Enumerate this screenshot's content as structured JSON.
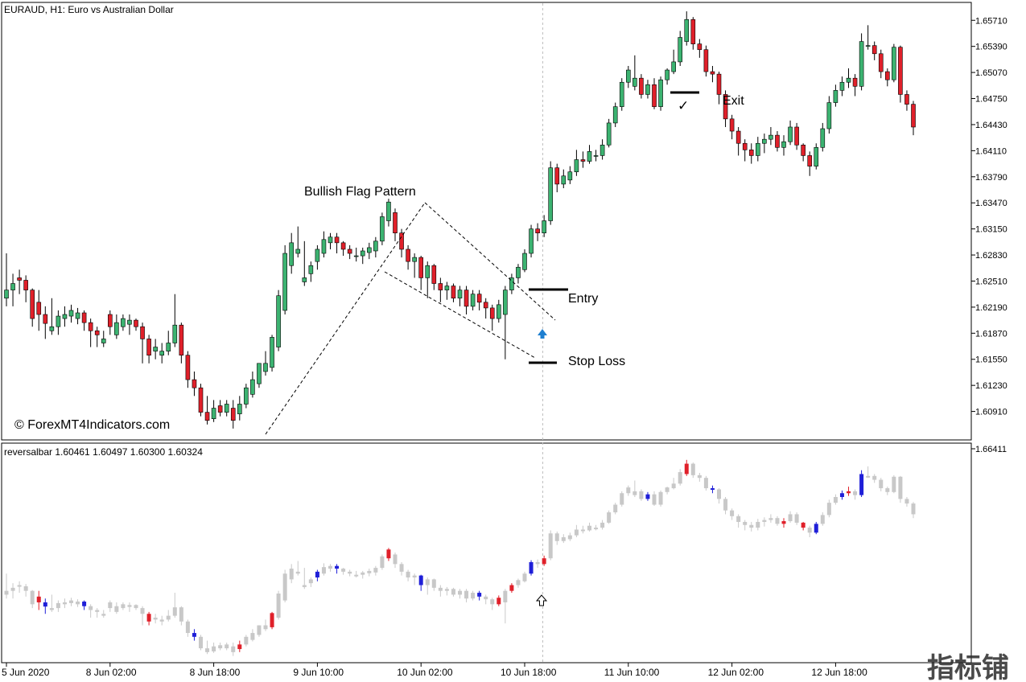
{
  "window": {
    "main_title": "EURAUD, H1:  Euro vs Australian Dollar",
    "indicator_title": "reversalbar 1.60461 1.60497 1.60300 1.60324",
    "watermark": "© ForexMT4Indicators.com",
    "corner_logo": "指标铺"
  },
  "annotations": {
    "pattern": "Bullish Flag Pattern",
    "entry": "Entry",
    "stop_loss": "Stop Loss",
    "exit": "Exit",
    "check_mark": "✓"
  },
  "colors": {
    "bull_candle": "#3cb371",
    "bear_candle": "#e0202a",
    "neutral_bar": "#c8c8c8",
    "signal_up": "#1f1fd8",
    "signal_down": "#e0202a",
    "arrow": "#1e7fd0",
    "grid_line": "#cfcfcf"
  },
  "chart_data": [
    {
      "type": "candlestick",
      "title": "EURAUD, H1:  Euro vs Australian Dollar",
      "y_ticks": [
        "1.65710",
        "1.65390",
        "1.65070",
        "1.64750",
        "1.64430",
        "1.64110",
        "1.63790",
        "1.63470",
        "1.63150",
        "1.62830",
        "1.62510",
        "1.62190",
        "1.61870",
        "1.61550",
        "1.61230",
        "1.60910"
      ],
      "ylim": [
        1.606,
        1.659
      ],
      "x_ticks": [
        "5 Jun 2020",
        "8 Jun 02:00",
        "8 Jun 18:00",
        "9 Jun 10:00",
        "10 Jun 02:00",
        "10 Jun 18:00",
        "11 Jun 10:00",
        "12 Jun 02:00",
        "12 Jun 18:00"
      ],
      "x_tick_index": [
        0,
        16,
        32,
        48,
        64,
        80,
        96,
        112,
        128
      ],
      "close": [
        1.624,
        1.6248,
        1.6252,
        1.624,
        1.6205,
        1.621,
        1.6199,
        1.6195,
        1.6208,
        1.621,
        1.6215,
        1.6212,
        1.62,
        1.619,
        1.6185,
        1.618,
        1.6195,
        1.62,
        1.6205,
        1.6203,
        1.6195,
        1.618,
        1.616,
        1.617,
        1.6165,
        1.6175,
        1.6197,
        1.616,
        1.613,
        1.612,
        1.609,
        1.608,
        1.6095,
        1.609,
        1.61,
        1.608,
        1.61,
        1.612,
        1.613,
        1.615,
        1.615,
        1.6182,
        1.6233,
        1.6285,
        1.6298,
        1.629,
        1.6255,
        1.627,
        1.629,
        1.6302,
        1.6305,
        1.6298,
        1.629,
        1.6285,
        1.6282,
        1.6288,
        1.6292,
        1.63,
        1.633,
        1.6348,
        1.631,
        1.629,
        1.6275,
        1.628,
        1.6255,
        1.627,
        1.6248,
        1.624,
        1.6245,
        1.623,
        1.624,
        1.622,
        1.6235,
        1.6225,
        1.6218,
        1.6205,
        1.6222,
        1.624,
        1.6255,
        1.6268,
        1.6285,
        1.6315,
        1.631,
        1.6325,
        1.639,
        1.637,
        1.638,
        1.6385,
        1.64,
        1.6398,
        1.641,
        1.6405,
        1.6418,
        1.6445,
        1.6465,
        1.6495,
        1.651,
        1.65,
        1.648,
        1.6492,
        1.6465,
        1.6498,
        1.651,
        1.652,
        1.655,
        1.6572,
        1.6542,
        1.6535,
        1.6508,
        1.6505,
        1.648,
        1.645,
        1.6435,
        1.642,
        1.6412,
        1.6405,
        1.642,
        1.6425,
        1.643,
        1.6415,
        1.6422,
        1.644,
        1.6418,
        1.6405,
        1.6392,
        1.6415,
        1.6438,
        1.647,
        1.6485,
        1.6495,
        1.65,
        1.649,
        1.6545,
        1.654,
        1.653,
        1.6508,
        1.6498,
        1.6538,
        1.648,
        1.6468,
        1.644
      ],
      "up_indices": [
        0,
        1,
        7,
        8,
        9,
        10,
        11,
        15,
        17,
        18,
        19,
        22,
        24,
        25,
        32,
        34,
        35,
        36,
        37,
        38,
        40,
        41,
        42,
        43,
        44,
        45,
        46,
        47,
        48,
        49,
        50,
        54,
        55,
        56,
        57,
        58,
        59,
        71,
        72,
        76,
        77,
        78,
        79,
        80,
        81,
        83,
        84,
        86,
        87,
        88,
        89,
        90,
        91,
        92,
        93,
        94,
        95,
        96,
        97,
        98,
        99,
        101,
        102,
        103,
        104,
        105,
        116,
        117,
        118,
        119,
        120,
        122,
        123,
        125,
        126,
        127,
        128,
        129,
        130,
        131,
        132,
        133,
        135
      ],
      "ohlc": [
        [
          1.623,
          1.6285,
          1.622,
          1.624
        ],
        [
          1.624,
          1.626,
          1.622,
          1.6248
        ],
        [
          1.6255,
          1.6265,
          1.6235,
          1.6252
        ],
        [
          1.6252,
          1.6258,
          1.6225,
          1.624
        ],
        [
          1.624,
          1.6242,
          1.6195,
          1.6205
        ],
        [
          1.6225,
          1.624,
          1.619,
          1.621
        ],
        [
          1.621,
          1.622,
          1.618,
          1.6199
        ],
        [
          1.619,
          1.623,
          1.6185,
          1.6195
        ],
        [
          1.6195,
          1.6215,
          1.6185,
          1.6208
        ],
        [
          1.6205,
          1.622,
          1.6195,
          1.621
        ],
        [
          1.6208,
          1.6222,
          1.62,
          1.6215
        ],
        [
          1.6205,
          1.6218,
          1.6198,
          1.6212
        ],
        [
          1.6212,
          1.6215,
          1.619,
          1.62
        ],
        [
          1.62,
          1.6205,
          1.617,
          1.619
        ],
        [
          1.619,
          1.6195,
          1.617,
          1.6185
        ],
        [
          1.6175,
          1.619,
          1.617,
          1.618
        ],
        [
          1.621,
          1.6215,
          1.6185,
          1.6195
        ],
        [
          1.6185,
          1.621,
          1.618,
          1.62
        ],
        [
          1.6195,
          1.621,
          1.619,
          1.6205
        ],
        [
          1.6198,
          1.621,
          1.6185,
          1.6203
        ],
        [
          1.6203,
          1.6205,
          1.619,
          1.6195
        ],
        [
          1.6195,
          1.62,
          1.615,
          1.618
        ],
        [
          1.618,
          1.6185,
          1.615,
          1.616
        ],
        [
          1.6165,
          1.618,
          1.6155,
          1.617
        ],
        [
          1.616,
          1.6175,
          1.615,
          1.6165
        ],
        [
          1.6165,
          1.619,
          1.616,
          1.6175
        ],
        [
          1.6175,
          1.6235,
          1.617,
          1.6197
        ],
        [
          1.6197,
          1.62,
          1.615,
          1.616
        ],
        [
          1.616,
          1.6165,
          1.612,
          1.613
        ],
        [
          1.613,
          1.614,
          1.611,
          1.612
        ],
        [
          1.612,
          1.6125,
          1.6085,
          1.609
        ],
        [
          1.609,
          1.611,
          1.6075,
          1.608
        ],
        [
          1.6082,
          1.6105,
          1.6078,
          1.6095
        ],
        [
          1.6098,
          1.6105,
          1.6085,
          1.609
        ],
        [
          1.609,
          1.6105,
          1.6085,
          1.61
        ],
        [
          1.6095,
          1.6105,
          1.607,
          1.608
        ],
        [
          1.6088,
          1.611,
          1.608,
          1.61
        ],
        [
          1.61,
          1.6125,
          1.6095,
          1.612
        ],
        [
          1.6112,
          1.614,
          1.6108,
          1.613
        ],
        [
          1.6125,
          1.615,
          1.612,
          1.615
        ],
        [
          1.614,
          1.6165,
          1.6135,
          1.615
        ],
        [
          1.6145,
          1.6185,
          1.614,
          1.6182
        ],
        [
          1.617,
          1.624,
          1.6165,
          1.6233
        ],
        [
          1.6215,
          1.6295,
          1.621,
          1.6285
        ],
        [
          1.627,
          1.631,
          1.626,
          1.6298
        ],
        [
          1.6285,
          1.6318,
          1.628,
          1.629
        ],
        [
          1.625,
          1.63,
          1.6245,
          1.6255
        ],
        [
          1.626,
          1.6275,
          1.625,
          1.627
        ],
        [
          1.6275,
          1.6295,
          1.6265,
          1.629
        ],
        [
          1.6285,
          1.6312,
          1.628,
          1.6302
        ],
        [
          1.6298,
          1.631,
          1.629,
          1.6305
        ],
        [
          1.6305,
          1.631,
          1.6285,
          1.6298
        ],
        [
          1.6298,
          1.63,
          1.6282,
          1.629
        ],
        [
          1.629,
          1.6295,
          1.6278,
          1.6285
        ],
        [
          1.6282,
          1.6292,
          1.6275,
          1.6282
        ],
        [
          1.6282,
          1.6292,
          1.6272,
          1.6288
        ],
        [
          1.6286,
          1.6298,
          1.6278,
          1.6292
        ],
        [
          1.6288,
          1.6305,
          1.628,
          1.63
        ],
        [
          1.63,
          1.6335,
          1.6295,
          1.633
        ],
        [
          1.6325,
          1.6352,
          1.6318,
          1.6348
        ],
        [
          1.6335,
          1.634,
          1.63,
          1.631
        ],
        [
          1.631,
          1.6315,
          1.628,
          1.629
        ],
        [
          1.629,
          1.6295,
          1.6265,
          1.6275
        ],
        [
          1.6275,
          1.6285,
          1.6255,
          1.628
        ],
        [
          1.628,
          1.6282,
          1.624,
          1.6255
        ],
        [
          1.6255,
          1.6275,
          1.623,
          1.627
        ],
        [
          1.627,
          1.6272,
          1.624,
          1.6248
        ],
        [
          1.6248,
          1.6255,
          1.6225,
          1.624
        ],
        [
          1.624,
          1.625,
          1.6228,
          1.6245
        ],
        [
          1.6245,
          1.6248,
          1.6225,
          1.623
        ],
        [
          1.623,
          1.6245,
          1.622,
          1.624
        ],
        [
          1.624,
          1.6245,
          1.621,
          1.622
        ],
        [
          1.622,
          1.624,
          1.6215,
          1.6235
        ],
        [
          1.6235,
          1.624,
          1.6215,
          1.6225
        ],
        [
          1.6225,
          1.623,
          1.6205,
          1.6218
        ],
        [
          1.6218,
          1.6222,
          1.619,
          1.6205
        ],
        [
          1.6205,
          1.6228,
          1.62,
          1.6222
        ],
        [
          1.621,
          1.6245,
          1.6155,
          1.624
        ],
        [
          1.624,
          1.626,
          1.6235,
          1.6255
        ],
        [
          1.6255,
          1.6272,
          1.6248,
          1.6268
        ],
        [
          1.6265,
          1.629,
          1.6262,
          1.6285
        ],
        [
          1.6285,
          1.632,
          1.628,
          1.6315
        ],
        [
          1.6315,
          1.6322,
          1.63,
          1.631
        ],
        [
          1.631,
          1.6332,
          1.6305,
          1.6325
        ],
        [
          1.6325,
          1.6398,
          1.632,
          1.639
        ],
        [
          1.639,
          1.6395,
          1.636,
          1.637
        ],
        [
          1.637,
          1.6388,
          1.6365,
          1.638
        ],
        [
          1.6375,
          1.6392,
          1.637,
          1.6385
        ],
        [
          1.6385,
          1.6412,
          1.638,
          1.64
        ],
        [
          1.64,
          1.641,
          1.639,
          1.6398
        ],
        [
          1.6398,
          1.6418,
          1.6395,
          1.641
        ],
        [
          1.6405,
          1.6412,
          1.6398,
          1.6405
        ],
        [
          1.6405,
          1.6425,
          1.64,
          1.6418
        ],
        [
          1.6418,
          1.645,
          1.6415,
          1.6445
        ],
        [
          1.6445,
          1.647,
          1.644,
          1.6465
        ],
        [
          1.6465,
          1.65,
          1.646,
          1.6495
        ],
        [
          1.6495,
          1.6515,
          1.6488,
          1.651
        ],
        [
          1.649,
          1.6528,
          1.6485,
          1.65
        ],
        [
          1.65,
          1.6505,
          1.6475,
          1.648
        ],
        [
          1.648,
          1.6498,
          1.6475,
          1.6492
        ],
        [
          1.6492,
          1.65,
          1.6462,
          1.6465
        ],
        [
          1.6465,
          1.6502,
          1.646,
          1.6498
        ],
        [
          1.6498,
          1.6512,
          1.6492,
          1.651
        ],
        [
          1.6508,
          1.6535,
          1.6505,
          1.652
        ],
        [
          1.652,
          1.6558,
          1.6515,
          1.655
        ],
        [
          1.6545,
          1.6582,
          1.654,
          1.6572
        ],
        [
          1.6572,
          1.6575,
          1.6535,
          1.6542
        ],
        [
          1.6542,
          1.6548,
          1.6525,
          1.6535
        ],
        [
          1.6535,
          1.654,
          1.6502,
          1.6508
        ],
        [
          1.6508,
          1.6515,
          1.6495,
          1.6505
        ],
        [
          1.6505,
          1.6508,
          1.6468,
          1.648
        ],
        [
          1.648,
          1.6485,
          1.644,
          1.645
        ],
        [
          1.645,
          1.6455,
          1.6425,
          1.6435
        ],
        [
          1.6435,
          1.644,
          1.6405,
          1.642
        ],
        [
          1.642,
          1.6425,
          1.6398,
          1.6412
        ],
        [
          1.6412,
          1.642,
          1.6395,
          1.6405
        ],
        [
          1.6405,
          1.6428,
          1.6398,
          1.642
        ],
        [
          1.642,
          1.6432,
          1.6408,
          1.6425
        ],
        [
          1.6425,
          1.644,
          1.6418,
          1.643
        ],
        [
          1.643,
          1.6435,
          1.641,
          1.6415
        ],
        [
          1.6415,
          1.643,
          1.6405,
          1.6422
        ],
        [
          1.6422,
          1.6448,
          1.6418,
          1.644
        ],
        [
          1.644,
          1.6445,
          1.6412,
          1.6418
        ],
        [
          1.6418,
          1.642,
          1.6398,
          1.6405
        ],
        [
          1.6405,
          1.641,
          1.638,
          1.6392
        ],
        [
          1.6392,
          1.642,
          1.6388,
          1.6415
        ],
        [
          1.6415,
          1.6445,
          1.641,
          1.6438
        ],
        [
          1.6438,
          1.6478,
          1.6432,
          1.647
        ],
        [
          1.647,
          1.6492,
          1.6465,
          1.6485
        ],
        [
          1.6485,
          1.6502,
          1.6478,
          1.6495
        ],
        [
          1.6495,
          1.6512,
          1.6488,
          1.65
        ],
        [
          1.65,
          1.6505,
          1.6478,
          1.649
        ],
        [
          1.649,
          1.6555,
          1.6485,
          1.6545
        ],
        [
          1.654,
          1.6565,
          1.6535,
          1.654
        ],
        [
          1.654,
          1.6545,
          1.6522,
          1.653
        ],
        [
          1.653,
          1.6535,
          1.65,
          1.6508
        ],
        [
          1.6508,
          1.6512,
          1.649,
          1.6498
        ],
        [
          1.6498,
          1.6542,
          1.6495,
          1.6538
        ],
        [
          1.6538,
          1.654,
          1.647,
          1.648
        ],
        [
          1.648,
          1.6485,
          1.646,
          1.6468
        ],
        [
          1.6468,
          1.6472,
          1.643,
          1.644
        ]
      ]
    },
    {
      "type": "bar",
      "title": "reversalbar 1.60461 1.60497 1.60300 1.60324",
      "y_ticks": [
        "1.66411"
      ],
      "signal_up_indices": [
        6,
        12,
        29,
        48,
        51,
        64,
        73,
        81,
        99,
        109,
        125,
        129,
        132
      ],
      "signal_down_indices": [
        5,
        22,
        36,
        41,
        59,
        76,
        78,
        83,
        105,
        120,
        123,
        130
      ]
    }
  ]
}
